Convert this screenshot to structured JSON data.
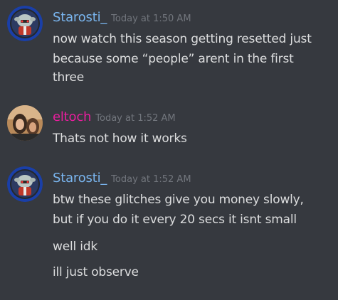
{
  "messages": [
    {
      "author": "Starosti_",
      "author_color": "#7ab6f0",
      "avatar": "robot-avatar-icon",
      "timestamp": "Today at 1:50 AM",
      "lines": [
        "now watch this season getting resetted just",
        "because some “people” arent in the first",
        "three"
      ]
    },
    {
      "author": "eltoch",
      "author_color": "#e91e9e",
      "avatar": "photo-avatar-icon",
      "timestamp": "Today at 1:52 AM",
      "lines": [
        "Thats not how it works"
      ]
    },
    {
      "author": "Starosti_",
      "author_color": "#7ab6f0",
      "avatar": "robot-avatar-icon",
      "timestamp": "Today at 1:52 AM",
      "lines": [
        "btw these glitches give you money slowly,",
        "but if you do it every 20 secs it isnt small",
        "well idk",
        "ill just observe"
      ]
    }
  ]
}
